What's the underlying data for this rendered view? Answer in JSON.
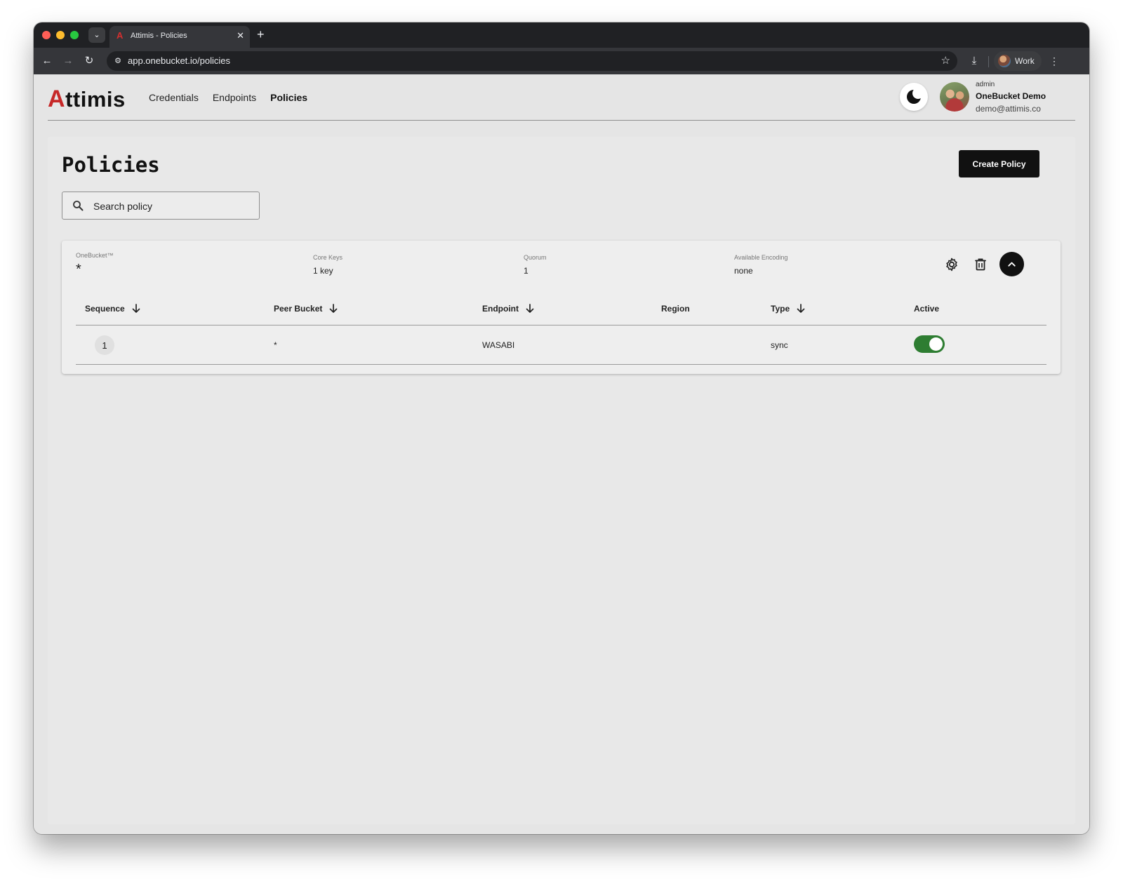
{
  "browser": {
    "tab_title": "Attimis - Policies",
    "url": "app.onebucket.io/policies",
    "profile_label": "Work"
  },
  "app": {
    "logo_first": "A",
    "logo_rest": "ttimis",
    "nav": [
      {
        "label": "Credentials",
        "active": false
      },
      {
        "label": "Endpoints",
        "active": false
      },
      {
        "label": "Policies",
        "active": true
      }
    ],
    "user": {
      "role": "admin",
      "name": "OneBucket Demo",
      "email": "demo@attimis.co"
    }
  },
  "page": {
    "title": "Policies",
    "create_label": "Create Policy",
    "search_placeholder": "Search policy"
  },
  "policy": {
    "bucket_label": "OneBucket™",
    "bucket_value": "*",
    "core_keys_label": "Core Keys",
    "core_keys_value": "1 key",
    "quorum_label": "Quorum",
    "quorum_value": "1",
    "encoding_label": "Available Encoding",
    "encoding_value": "none",
    "columns": {
      "sequence": "Sequence",
      "peer_bucket": "Peer Bucket",
      "endpoint": "Endpoint",
      "region": "Region",
      "type": "Type",
      "active": "Active"
    },
    "rows": [
      {
        "sequence": "1",
        "peer_bucket": "*",
        "endpoint": "WASABI",
        "region": "",
        "type": "sync",
        "active": true
      }
    ]
  },
  "colors": {
    "brand_red": "#c62828",
    "toggle_on": "#2e7d32",
    "primary_button": "#111111"
  }
}
